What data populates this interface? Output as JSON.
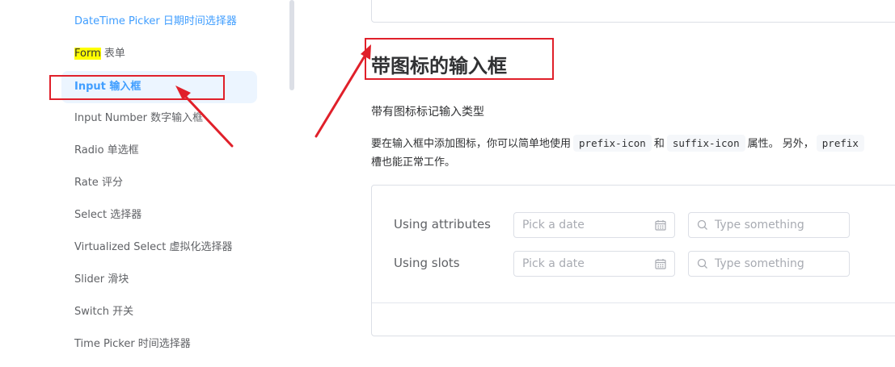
{
  "sidebar": {
    "items": [
      {
        "label": "DateTime Picker 日期时间选择器"
      },
      {
        "label_hl": "Form",
        "label_rest": " 表单"
      },
      {
        "label": "Input 输入框"
      },
      {
        "label": "Input Number 数字输入框"
      },
      {
        "label": "Radio 单选框"
      },
      {
        "label": "Rate 评分"
      },
      {
        "label": "Select 选择器"
      },
      {
        "label": "Virtualized Select 虚拟化选择器"
      },
      {
        "label": "Slider 滑块"
      },
      {
        "label": "Switch 开关"
      },
      {
        "label": "Time Picker 时间选择器"
      }
    ]
  },
  "main": {
    "title": "带图标的输入框",
    "subtitle": "带有图标标记输入类型",
    "para": {
      "t1": "要在输入框中添加图标，你可以简单地使用",
      "code1": "prefix-icon",
      "t2": "和",
      "code2": "suffix-icon",
      "t3": "属性。 另外，",
      "code3": "prefix",
      "line2": "槽也能正常工作。"
    },
    "demo": {
      "rows": [
        {
          "label": "Using attributes",
          "date_placeholder": "Pick a date",
          "search_placeholder": "Type something"
        },
        {
          "label": "Using slots",
          "date_placeholder": "Pick a date",
          "search_placeholder": "Type something"
        }
      ]
    }
  },
  "colors": {
    "accent": "#409eff",
    "annotation": "#e0202a",
    "highlight": "#ffff00"
  },
  "icons": [
    "calendar-icon",
    "search-icon"
  ]
}
